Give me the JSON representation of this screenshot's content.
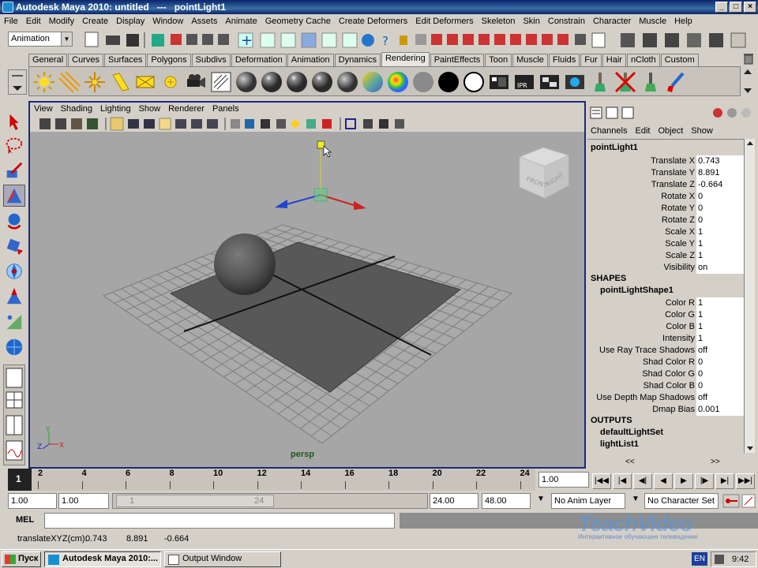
{
  "window": {
    "title": "Autodesk Maya 2010: untitled   ---   pointLight1",
    "controls": [
      "_",
      "□",
      "×"
    ]
  },
  "menubar": [
    "File",
    "Edit",
    "Modify",
    "Create",
    "Display",
    "Window",
    "Assets",
    "Animate",
    "Geometry Cache",
    "Create Deformers",
    "Edit Deformers",
    "Skeleton",
    "Skin",
    "Constrain",
    "Character",
    "Muscle",
    "Help"
  ],
  "statusline": {
    "menu_set": "Animation"
  },
  "shelf": {
    "tabs": [
      "General",
      "Curves",
      "Surfaces",
      "Polygons",
      "Subdivs",
      "Deformation",
      "Animation",
      "Dynamics",
      "Rendering",
      "PaintEffects",
      "Toon",
      "Muscle",
      "Fluids",
      "Fur",
      "Hair",
      "nCloth",
      "Custom"
    ],
    "active": "Rendering",
    "icons": [
      "ambient-light-icon",
      "directional-light-icon",
      "point-light-icon",
      "spot-light-icon",
      "area-light-icon",
      "volume-light-icon",
      "camera-icon",
      "hypershade-icon",
      "lambert-icon",
      "blinn-icon",
      "phong-icon",
      "phong-e-icon",
      "anisotropic-icon",
      "ramp-shader-icon",
      "layered-shader-icon",
      "surface-shader-icon",
      "use-background-icon",
      "render-icon",
      "ipr-render-icon",
      "render-settings-icon",
      "render-view-icon",
      "paint-brush-icon",
      "delete-paint-icon",
      "paint-fx-icon"
    ]
  },
  "viewport": {
    "menus": [
      "View",
      "Shading",
      "Lighting",
      "Show",
      "Renderer",
      "Panels"
    ],
    "camera_label": "persp",
    "viewcube": {
      "front": "FRONT",
      "right": "RIGHT"
    },
    "axis": {
      "x": "X",
      "y": "Y",
      "z": "Z"
    }
  },
  "channel_box": {
    "menus": [
      "Channels",
      "Edit",
      "Object",
      "Show"
    ],
    "object": "pointLight1",
    "transform": [
      {
        "label": "Translate X",
        "value": "0.743"
      },
      {
        "label": "Translate Y",
        "value": "8.891"
      },
      {
        "label": "Translate Z",
        "value": "-0.664"
      },
      {
        "label": "Rotate X",
        "value": "0"
      },
      {
        "label": "Rotate Y",
        "value": "0"
      },
      {
        "label": "Rotate Z",
        "value": "0"
      },
      {
        "label": "Scale X",
        "value": "1"
      },
      {
        "label": "Scale Y",
        "value": "1"
      },
      {
        "label": "Scale Z",
        "value": "1"
      },
      {
        "label": "Visibility",
        "value": "on"
      }
    ],
    "shapes_header": "SHAPES",
    "shape_name": "pointLightShape1",
    "shape_attrs": [
      {
        "label": "Color R",
        "value": "1"
      },
      {
        "label": "Color G",
        "value": "1"
      },
      {
        "label": "Color B",
        "value": "1"
      },
      {
        "label": "Intensity",
        "value": "1"
      },
      {
        "label": "Use Ray Trace Shadows",
        "value": "off"
      },
      {
        "label": "Shad Color R",
        "value": "0"
      },
      {
        "label": "Shad Color G",
        "value": "0"
      },
      {
        "label": "Shad Color B",
        "value": "0"
      },
      {
        "label": "Use Depth Map Shadows",
        "value": "off"
      },
      {
        "label": "Dmap Bias",
        "value": "0.001"
      }
    ],
    "outputs_header": "OUTPUTS",
    "outputs": [
      "defaultLightSet",
      "lightList1"
    ],
    "scroll": {
      "left": "<<",
      "right": ">>"
    }
  },
  "timeline": {
    "current_frame": "1",
    "ticks": [
      "2",
      "4",
      "6",
      "8",
      "10",
      "12",
      "14",
      "16",
      "18",
      "20",
      "22",
      "24"
    ],
    "current_time": "1.00"
  },
  "range": {
    "start": "1.00",
    "playback_start": "1.00",
    "slider_start": "1",
    "slider_end": "24",
    "playback_end": "24.00",
    "end": "48.00",
    "anim_layer": "No Anim Layer",
    "character_set": "No Character Set"
  },
  "command": {
    "label": "MEL",
    "help": "translateXYZ(cm):",
    "values": [
      "0.743",
      "8.891",
      "-0.664"
    ]
  },
  "taskbar": {
    "start": "Пуск",
    "apps": [
      "Autodesk Maya 2010:...",
      "Output Window"
    ],
    "lang": "EN",
    "time": "9:42"
  },
  "watermark": {
    "title": "TeachVideo",
    "subtitle": "Интерактивное обучающее телевидение"
  }
}
